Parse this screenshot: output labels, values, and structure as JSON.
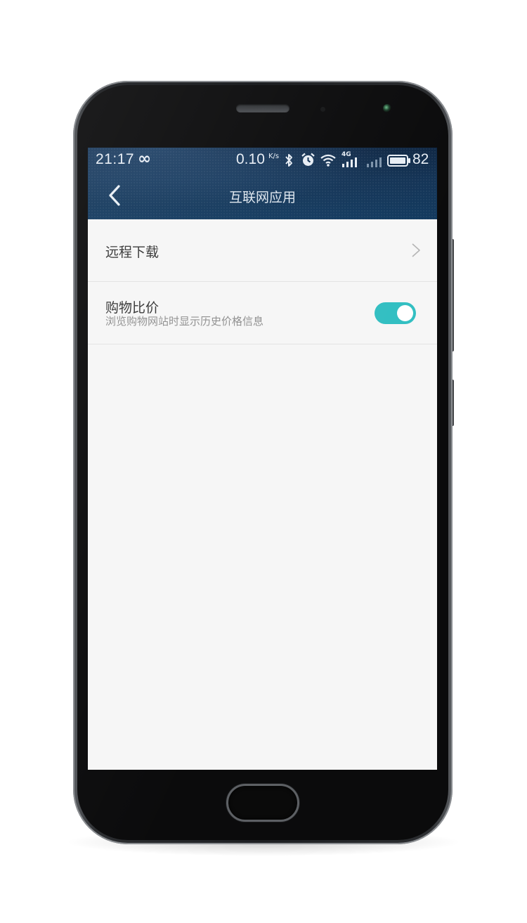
{
  "status_bar": {
    "time": "21:17",
    "loop_symbol": "∞",
    "net_speed": "0.10",
    "net_speed_unit": "K/s",
    "signal_label": "4G",
    "battery_level": "82",
    "icons": [
      "infinity-icon",
      "bluetooth-icon",
      "alarm-icon",
      "wifi-icon",
      "signal-4g-icon",
      "signal-icon",
      "battery-icon"
    ]
  },
  "nav": {
    "back_icon": "chevron-left-icon",
    "title": "互联网应用"
  },
  "settings": [
    {
      "title": "远程下载",
      "control": "chevron-right-icon"
    },
    {
      "title": "购物比价",
      "subtitle": "浏览购物网站时显示历史价格信息",
      "control": "toggle",
      "enabled": true
    }
  ],
  "colors": {
    "header": "#143456",
    "toggle_on": "#33bfc2",
    "background": "#f6f6f6"
  }
}
